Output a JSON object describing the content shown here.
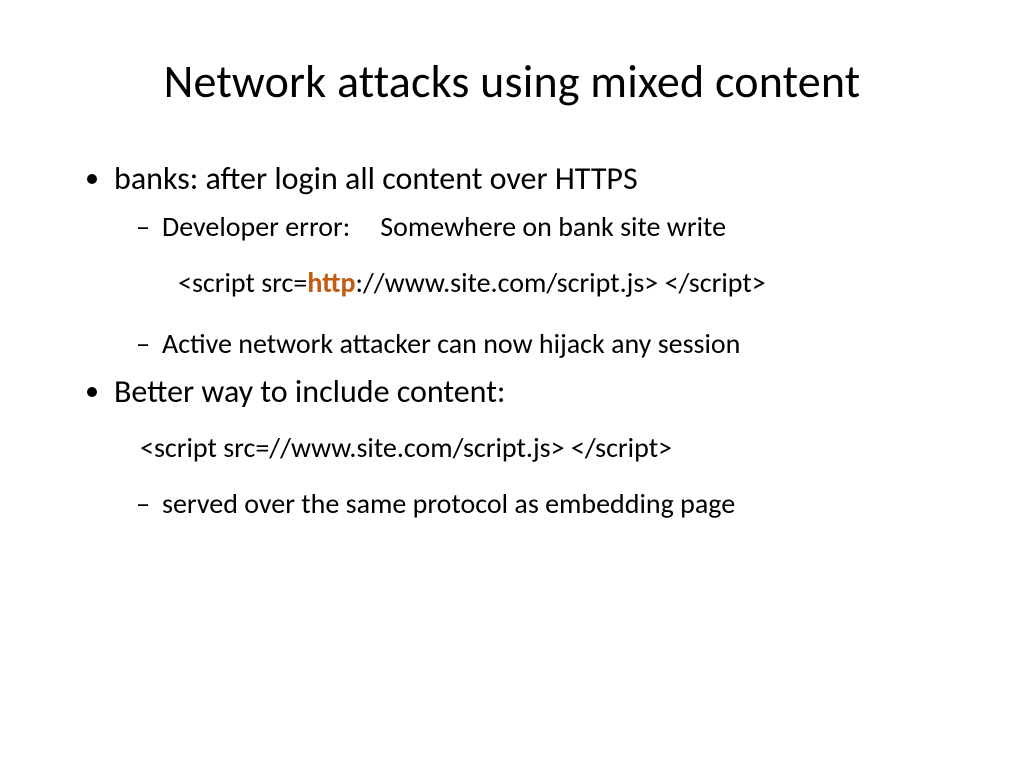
{
  "title": "Network attacks using mixed content",
  "b1": "banks: after login all content over HTTPS",
  "b1s1a": "Developer error:",
  "b1s1b": "Somewhere on bank site write",
  "code1_pre": "<script src=",
  "code1_hl": "http",
  "code1_post": "://www.site.com/script.js> </script>",
  "b1s2": "Active network attacker can now hijack any session",
  "b2": "Better way to include content:",
  "code2": "<script src=//www.site.com/script.js> </script>",
  "b2s1": "served over the same protocol as embedding page"
}
